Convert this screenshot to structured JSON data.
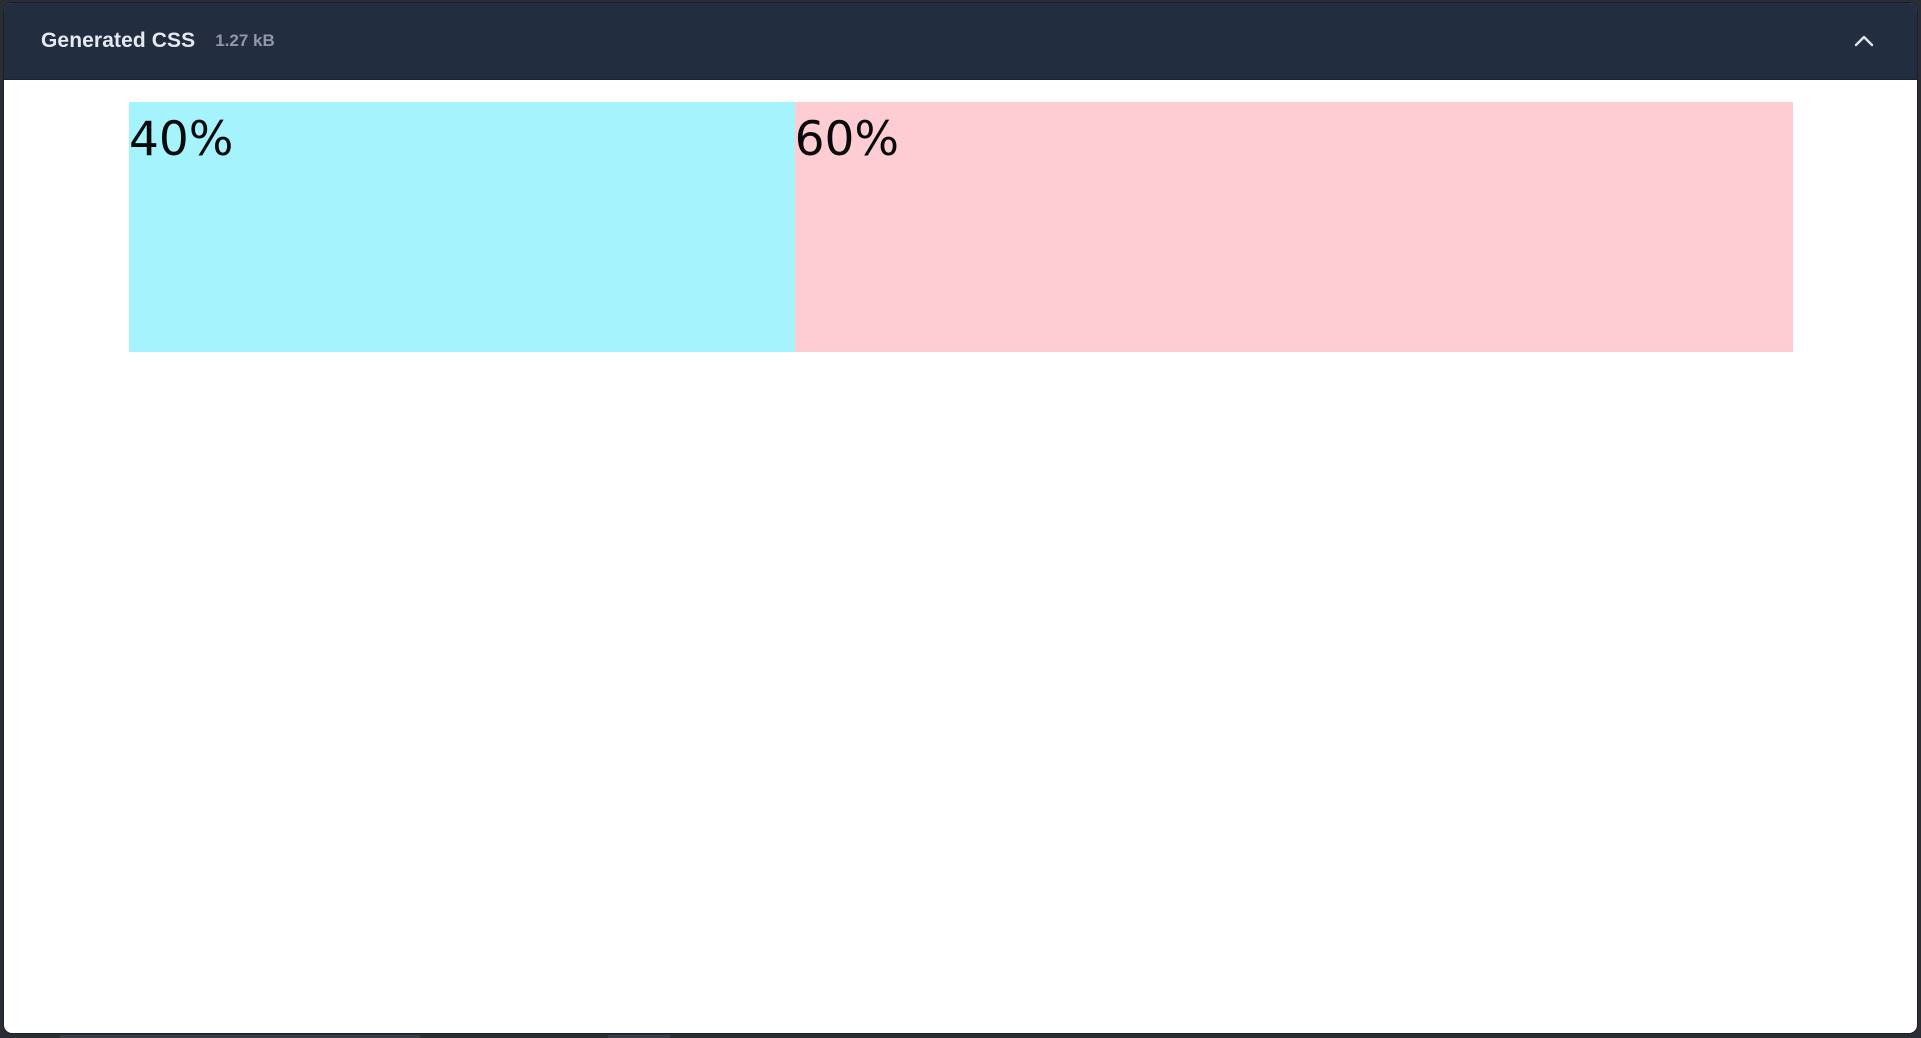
{
  "panel": {
    "title": "Generated CSS",
    "size": "1.27 kB",
    "collapse_icon": "chevron-up-icon",
    "colors": {
      "header_bg": "#222d3f",
      "title": "#e6e9ef",
      "size": "#8e98a9"
    }
  },
  "preview": {
    "cells": [
      {
        "label": "40%",
        "fraction": 0.4,
        "color": "#a5f3fc"
      },
      {
        "label": "60%",
        "fraction": 0.6,
        "color": "#fecdd3"
      }
    ]
  }
}
